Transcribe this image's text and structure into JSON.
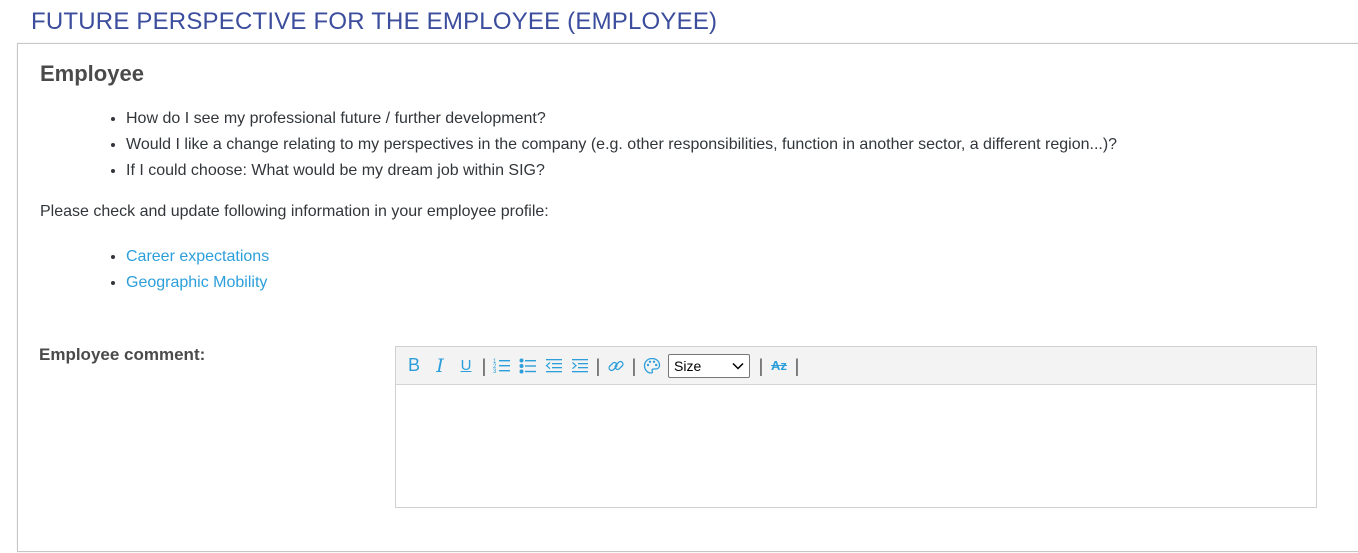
{
  "section": {
    "title": "FUTURE PERSPECTIVE FOR THE EMPLOYEE (EMPLOYEE)"
  },
  "panel": {
    "heading": "Employee",
    "questions": [
      "How do I see my professional future / further development?",
      "Would I like a change relating to my perspectives in the company (e.g. other responsibilities, function in another sector, a different region...)?",
      "If I could choose: What would be my dream job within SIG?"
    ],
    "intro": "Please check and update following information in your employee profile:",
    "links": [
      "Career expectations",
      "Geographic Mobility"
    ],
    "comment_label": "Employee comment:"
  },
  "editor": {
    "toolbar": {
      "bold": "B",
      "italic": "I",
      "underline": "U",
      "size_select": "Size",
      "clear_format": "Az"
    },
    "content": ""
  },
  "colors": {
    "title": "#3b4d9c",
    "link": "#2c9fdb",
    "icon": "#2c9fdb"
  }
}
